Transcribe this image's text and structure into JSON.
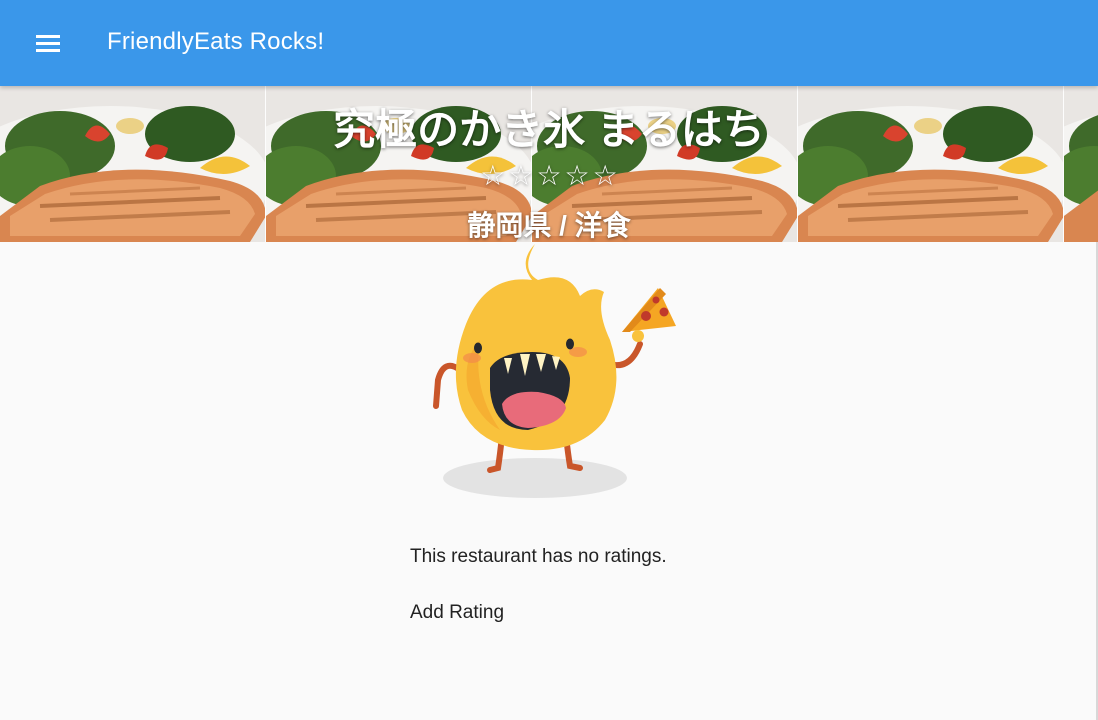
{
  "app_bar": {
    "title": "FriendlyEats Rocks!",
    "menu_icon": "menu-icon",
    "background": "#3a97ea"
  },
  "restaurant": {
    "name": "究極のかき氷 まるはち",
    "rating_stars": [
      "☆",
      "☆",
      "☆",
      "☆",
      "☆"
    ],
    "location_category": "静岡県 / 洋食"
  },
  "hero": {
    "image": "grilled-salmon-salad-photo"
  },
  "mascot": {
    "icon": "fire-mascot-with-pizza-illustration"
  },
  "ratings": {
    "empty_message": "This restaurant has no ratings.",
    "add_rating_label": "Add Rating"
  }
}
